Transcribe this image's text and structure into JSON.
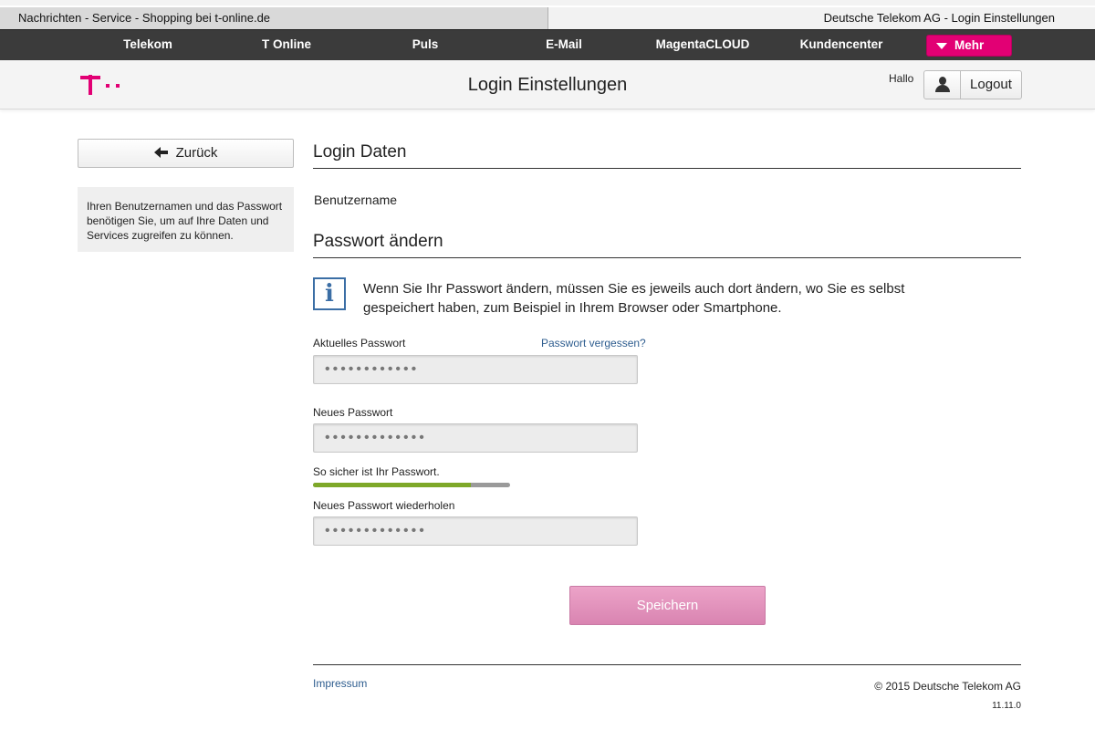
{
  "browser_tabs": {
    "left": "Nachrichten - Service - Shopping bei t-online.de",
    "right": "Deutsche Telekom AG - Login Einstellungen"
  },
  "nav": {
    "items": [
      "Telekom",
      "T Online",
      "Puls",
      "E-Mail",
      "MagentaCLOUD",
      "Kundencenter"
    ],
    "more_label": "Mehr"
  },
  "header": {
    "title": "Login Einstellungen",
    "greeting": "Hallo",
    "logout_label": "Logout"
  },
  "sidebar": {
    "back_label": "Zurück",
    "info_text": "Ihren Benutzernamen und das Passwort benötigen Sie, um auf Ihre Daten und Services zugreifen zu können."
  },
  "login_data": {
    "title": "Login Daten",
    "username_label": "Benutzername"
  },
  "password_change": {
    "title": "Passwort ändern",
    "notice": "Wenn Sie Ihr Passwort ändern, müssen Sie es jeweils auch dort ändern, wo Sie es selbst gespeichert haben, zum Beispiel in Ihrem Browser oder Smartphone.",
    "current_label": "Aktuelles Passwort",
    "forgot_link": "Passwort vergessen?",
    "current_value": "••••••••••••",
    "new_label": "Neues Passwort",
    "new_value": "•••••••••••••",
    "strength_label": "So sicher ist Ihr Passwort.",
    "strength_level": 0.8,
    "repeat_label": "Neues Passwort wiederholen",
    "repeat_value": "•••••••••••••",
    "save_label": "Speichern"
  },
  "footer": {
    "impressum": "Impressum",
    "copyright": "© 2015 Deutsche Telekom AG",
    "version": "11.11.0"
  },
  "colors": {
    "brand": "#e20074",
    "link": "#2e5d8f",
    "strength": "#7ea829"
  }
}
